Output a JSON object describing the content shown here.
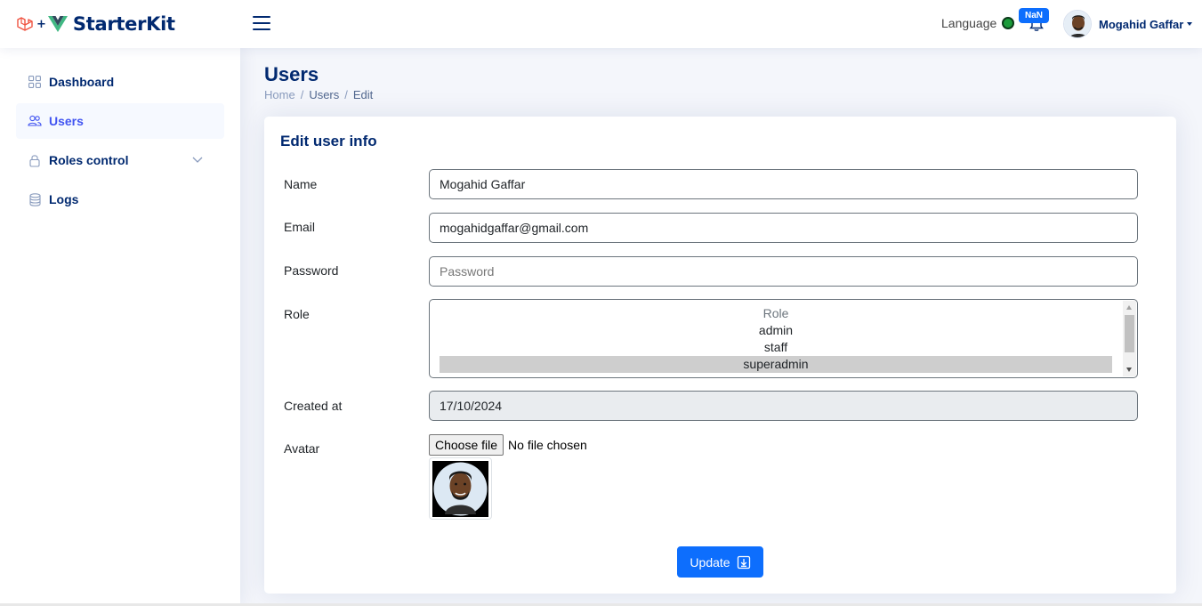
{
  "header": {
    "brand": "StarterKit",
    "logo_plus": "+",
    "language_label": "Language",
    "notification_badge": "NaN",
    "user_name": "Mogahid Gaffar"
  },
  "sidebar": {
    "items": [
      {
        "label": "Dashboard",
        "icon": "grid-icon"
      },
      {
        "label": "Users",
        "icon": "users-icon",
        "active": true
      },
      {
        "label": "Roles control",
        "icon": "lock-icon"
      },
      {
        "label": "Logs",
        "icon": "database-icon"
      }
    ]
  },
  "page": {
    "title": "Users",
    "breadcrumb": [
      "Home",
      "Users",
      "Edit"
    ],
    "breadcrumb_sep": "/"
  },
  "form": {
    "title": "Edit user info",
    "name_label": "Name",
    "name_value": "Mogahid Gaffar",
    "email_label": "Email",
    "email_value": "mogahidgaffar@gmail.com",
    "password_label": "Password",
    "password_placeholder": "Password",
    "role_label": "Role",
    "role_options": [
      "Role",
      "admin",
      "staff",
      "superadmin"
    ],
    "role_selected": "superadmin",
    "created_label": "Created at",
    "created_value": "17/10/2024",
    "avatar_label": "Avatar",
    "file_button": "Choose file",
    "file_status": "No file chosen",
    "submit_label": "Update"
  },
  "colors": {
    "brand": "#012970",
    "primary": "#0d6efd",
    "active_nav": "#4154f1",
    "language_dot": "#1b9b3a"
  }
}
